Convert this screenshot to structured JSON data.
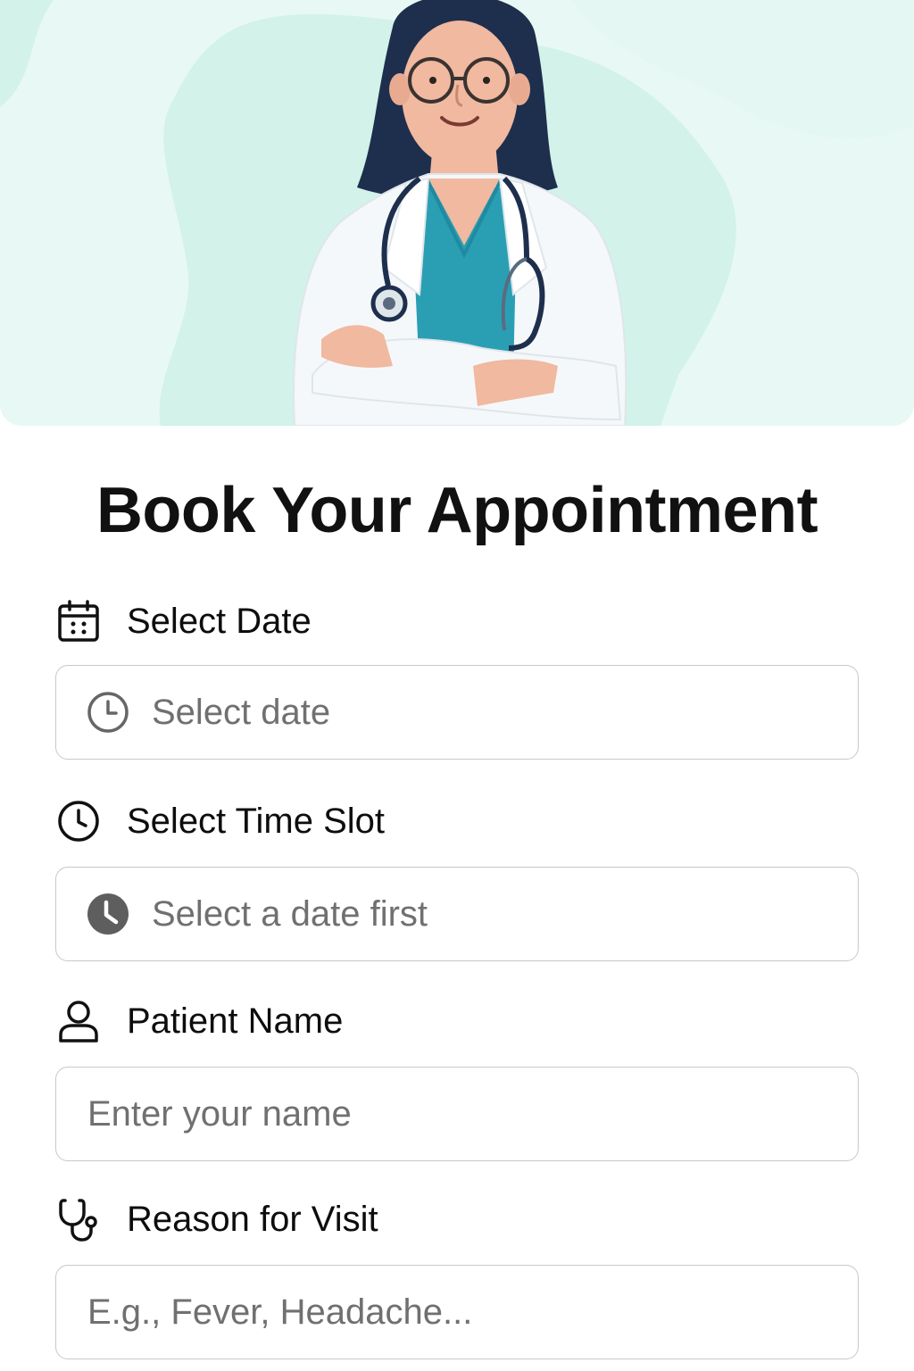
{
  "page": {
    "title": "Book Your Appointment"
  },
  "form": {
    "date": {
      "label": "Select Date",
      "label_icon": "calendar-icon",
      "placeholder": "Select date",
      "field_icon": "clock-outline-icon"
    },
    "time_slot": {
      "label": "Select Time Slot",
      "label_icon": "clock-icon",
      "placeholder": "Select a date first",
      "field_icon": "clock-filled-icon"
    },
    "patient_name": {
      "label": "Patient Name",
      "label_icon": "user-icon",
      "placeholder": "Enter your name",
      "value": ""
    },
    "reason": {
      "label": "Reason for Visit",
      "label_icon": "stethoscope-icon",
      "placeholder": "E.g., Fever, Headache...",
      "value": ""
    }
  },
  "colors": {
    "hero_background": "#e8f8f4",
    "hero_blob": "#d2f2ea",
    "scrubs": "#2a9fb4",
    "hair": "#1e2f4d",
    "input_border": "#c8c8c8",
    "placeholder_text": "#707070"
  }
}
